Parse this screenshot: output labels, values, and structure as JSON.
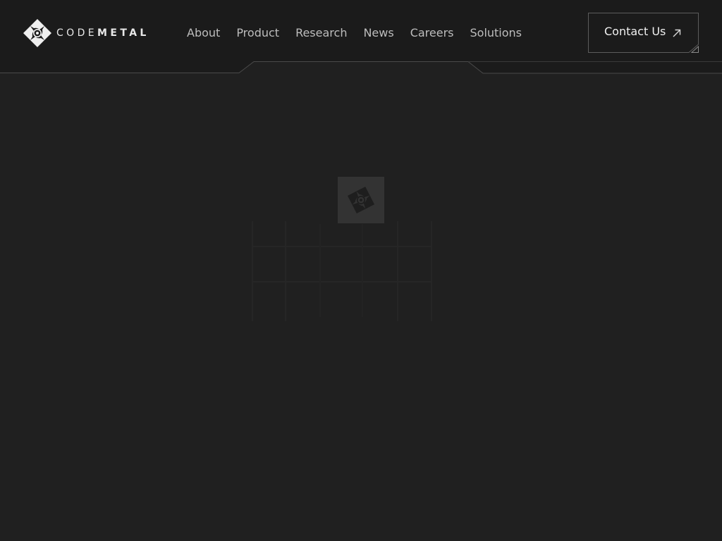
{
  "brand": {
    "name_light": "CODE",
    "name_bold": "METAL"
  },
  "nav": {
    "items": [
      {
        "label": "About"
      },
      {
        "label": "Product"
      },
      {
        "label": "Research"
      },
      {
        "label": "News"
      },
      {
        "label": "Careers"
      },
      {
        "label": "Solutions"
      }
    ]
  },
  "cta": {
    "label": "Contact Us",
    "icon": "arrow-up-right-icon"
  },
  "loader": {
    "icon": "codemetal-logo-icon"
  },
  "colors": {
    "background": "#202020",
    "header": "#1b1b1b",
    "header_line": "#4a4a4a",
    "nav_text": "#bdbdbd",
    "text": "#f0f0f0"
  }
}
